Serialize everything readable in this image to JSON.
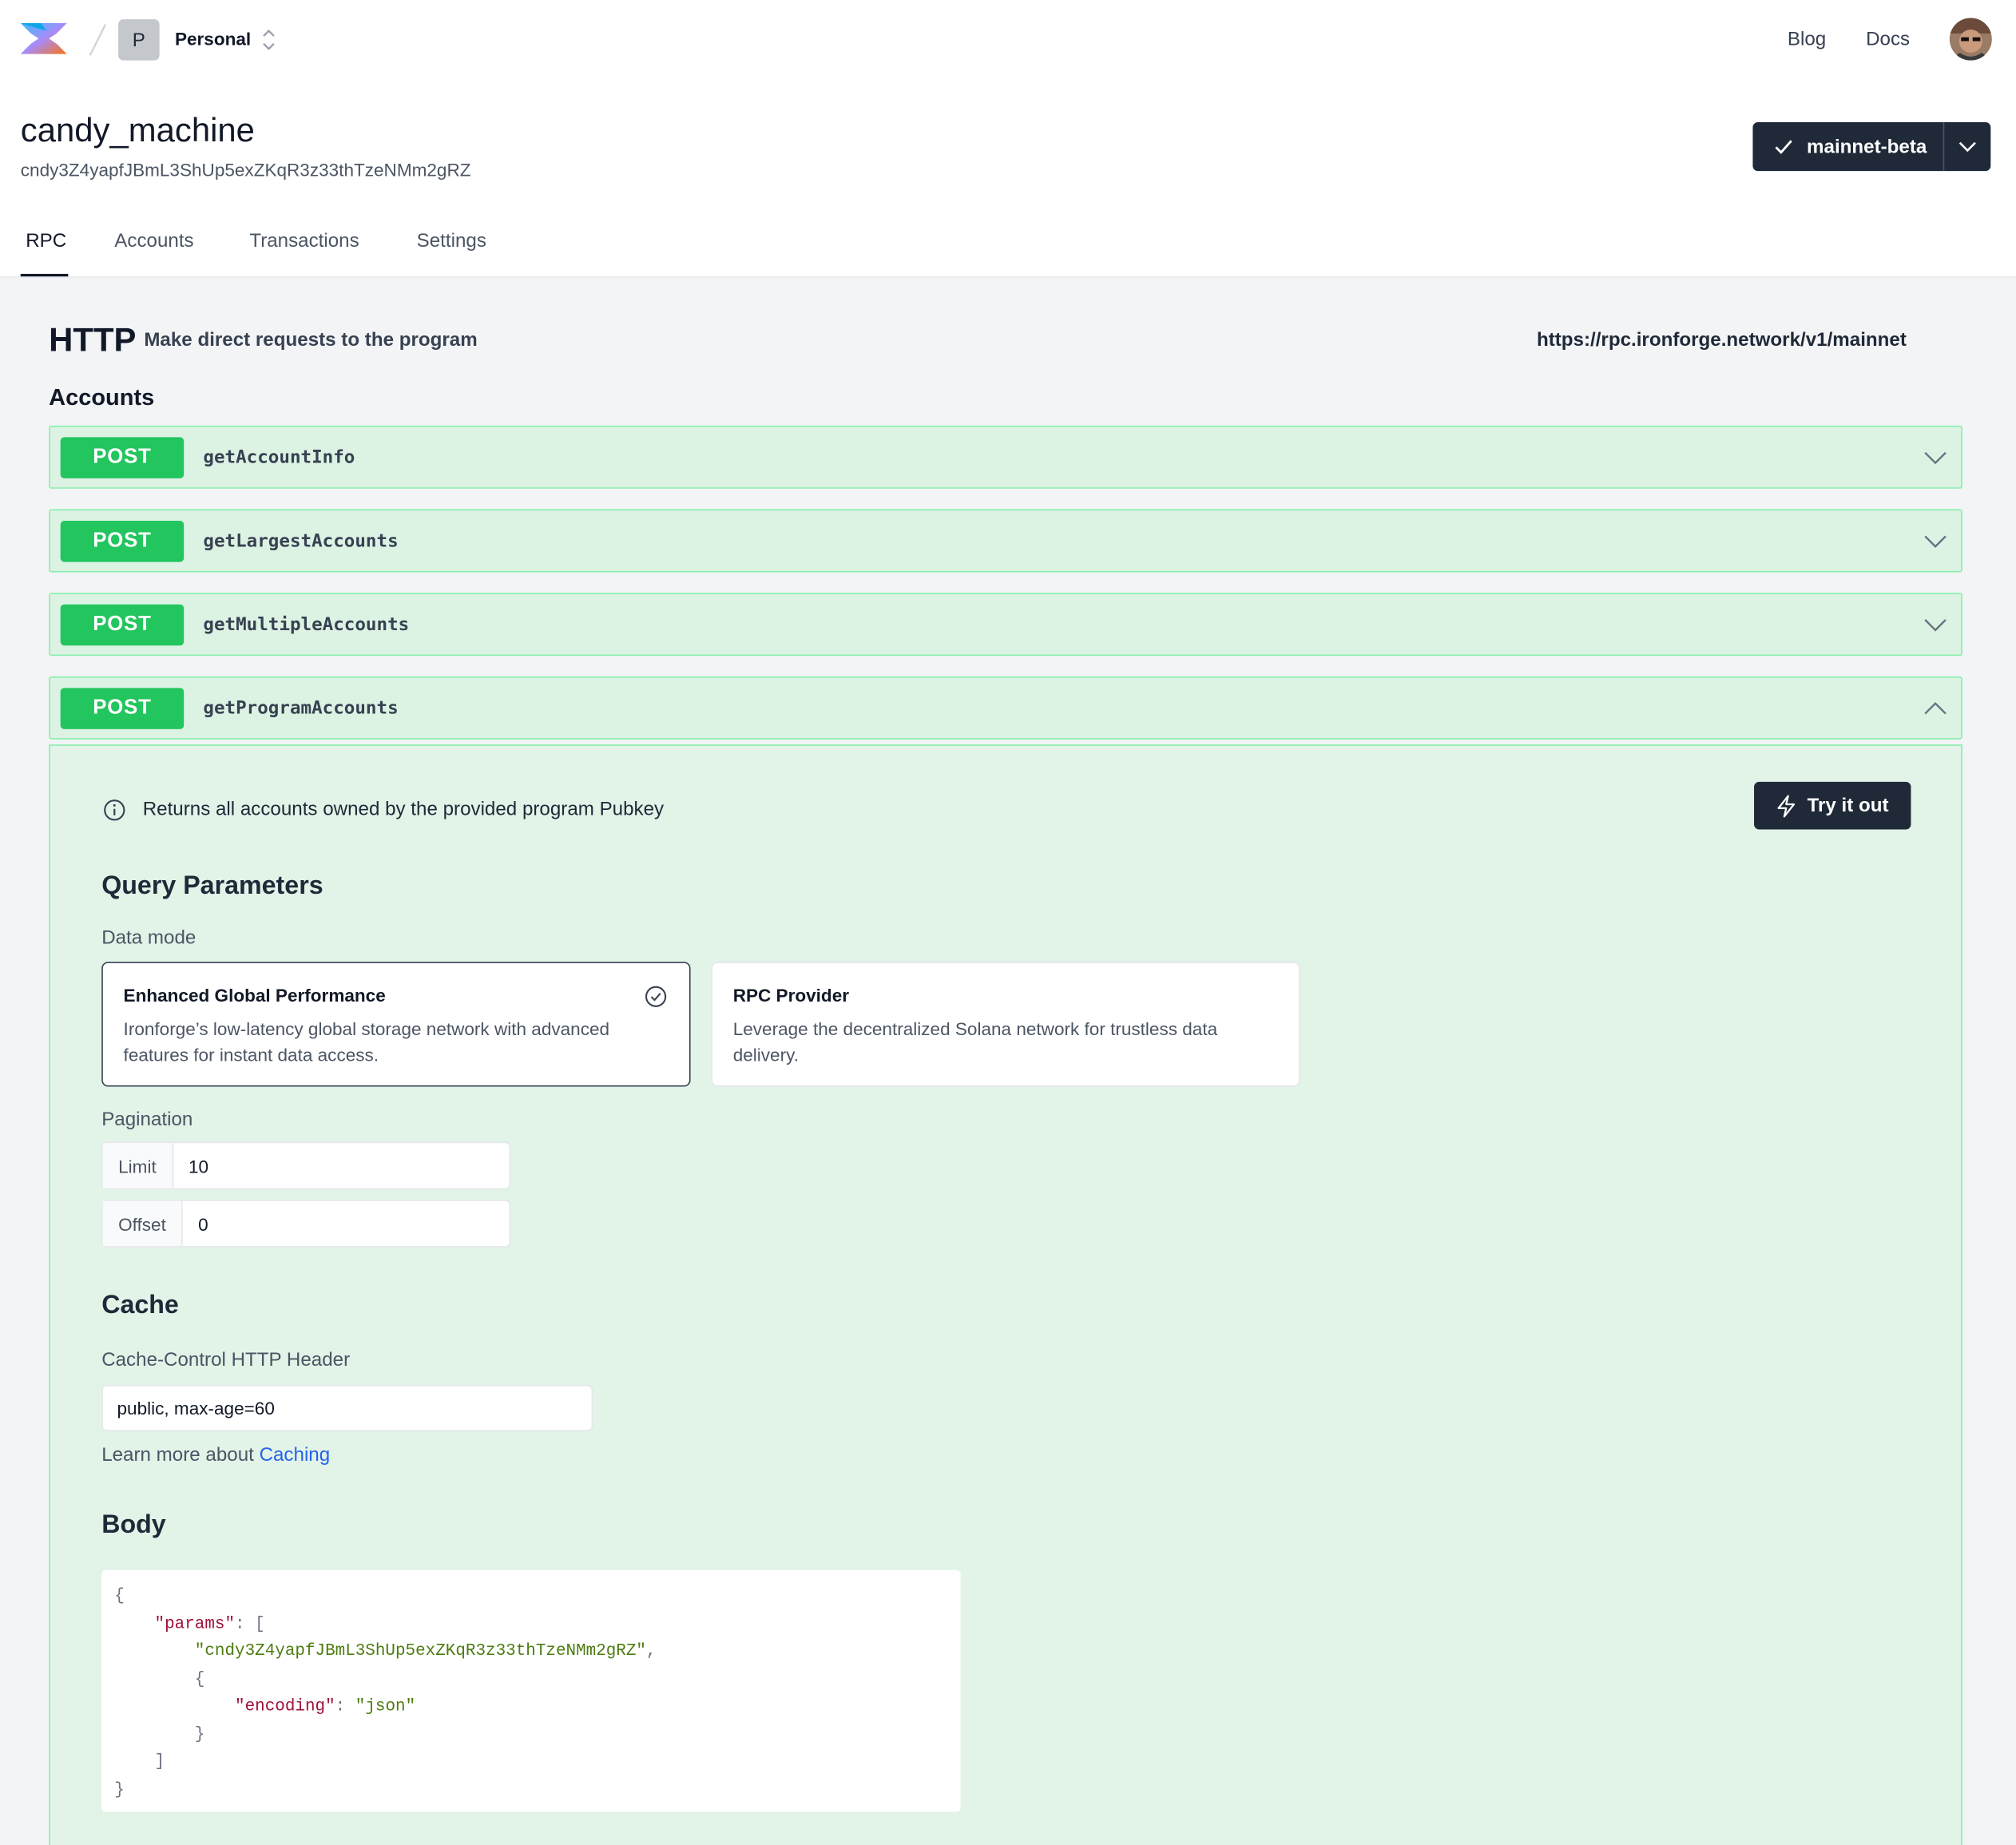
{
  "header": {
    "workspace_initial": "P",
    "workspace_name": "Personal",
    "nav": {
      "blog": "Blog",
      "docs": "Docs"
    }
  },
  "program": {
    "name": "candy_machine",
    "address": "cndy3Z4yapfJBmL3ShUp5exZKqR3z33thTzeNMm2gRZ",
    "network": "mainnet-beta"
  },
  "tabs": [
    "RPC",
    "Accounts",
    "Transactions",
    "Settings"
  ],
  "http": {
    "title": "HTTP",
    "subtitle": "Make direct requests to the program",
    "url": "https://rpc.ironforge.network/v1/mainnet"
  },
  "section_title": "Accounts",
  "endpoints": [
    {
      "method": "POST",
      "name": "getAccountInfo",
      "expanded": false
    },
    {
      "method": "POST",
      "name": "getLargestAccounts",
      "expanded": false
    },
    {
      "method": "POST",
      "name": "getMultipleAccounts",
      "expanded": false
    },
    {
      "method": "POST",
      "name": "getProgramAccounts",
      "expanded": true
    }
  ],
  "detail": {
    "description": "Returns all accounts owned by the provided program Pubkey",
    "try_label": "Try it out",
    "query_title": "Query Parameters",
    "data_mode_label": "Data mode",
    "modes": [
      {
        "title": "Enhanced Global Performance",
        "desc": "Ironforge’s low-latency global storage network with advanced features for instant data access.",
        "selected": true
      },
      {
        "title": "RPC Provider",
        "desc": "Leverage the decentralized Solana network for trustless data delivery.",
        "selected": false
      }
    ],
    "pagination_label": "Pagination",
    "limit_label": "Limit",
    "limit_value": "10",
    "offset_label": "Offset",
    "offset_value": "0",
    "cache_title": "Cache",
    "cache_header_label": "Cache-Control HTTP Header",
    "cache_value": "public, max-age=60",
    "learn_prefix": "Learn more about",
    "learn_link": "Caching",
    "body_title": "Body",
    "body": {
      "params_key": "\"params\"",
      "address": "\"cndy3Z4yapfJBmL3ShUp5exZKqR3z33thTzeNMm2gRZ\"",
      "encoding_key": "\"encoding\"",
      "encoding_value": "\"json\""
    }
  },
  "colors": {
    "post_badge": "#22c55e",
    "endpoint_bg": "#dcf3e4",
    "dark_button": "#1f2937",
    "link": "#2563eb"
  }
}
